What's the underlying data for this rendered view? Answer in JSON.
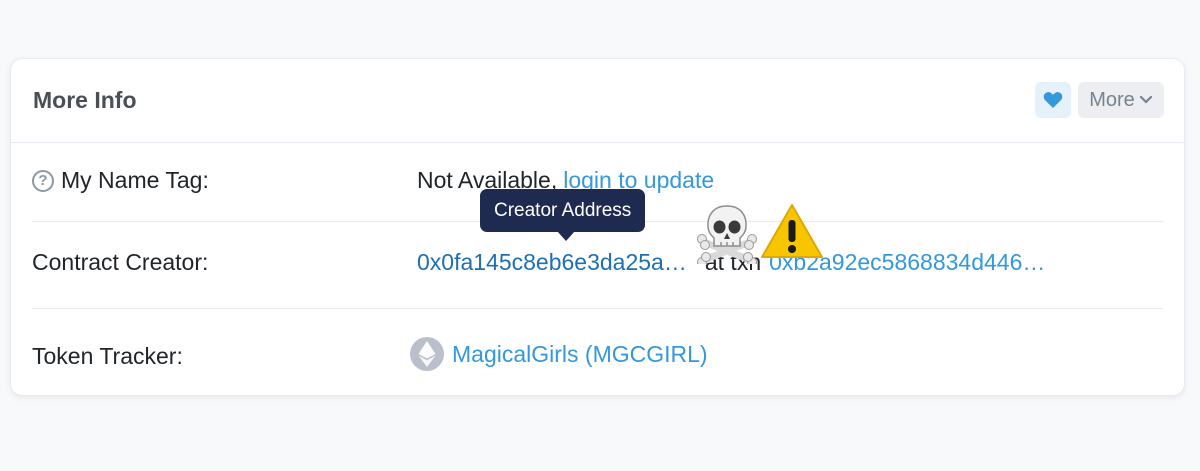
{
  "card": {
    "title": "More Info",
    "favorite_icon": "heart-icon",
    "more_label": "More",
    "more_icon": "chevron-down-icon"
  },
  "rows": {
    "name_tag": {
      "label": "My Name Tag:",
      "help_icon": "question-circle-icon",
      "value_text": "Not Available,",
      "value_link": "login to update"
    },
    "creator": {
      "label": "Contract Creator:",
      "address": "0x0fa145c8eb6e3da25a…",
      "at_text": "at txn",
      "txn_hash": "0xb2a92ec5868834d446…"
    },
    "token_tracker": {
      "label": "Token Tracker:",
      "token_icon": "ethereum-icon",
      "token_link": "MagicalGirls (MGCGIRL)"
    }
  },
  "tooltip": {
    "text": "Creator Address"
  },
  "overlay": {
    "skull_icon": "skull-crossbones-icon",
    "warning_icon": "warning-icon"
  },
  "colors": {
    "link": "#3498db",
    "tooltip_bg": "#1e2a4f",
    "accent_bg": "#e5f1fb"
  }
}
